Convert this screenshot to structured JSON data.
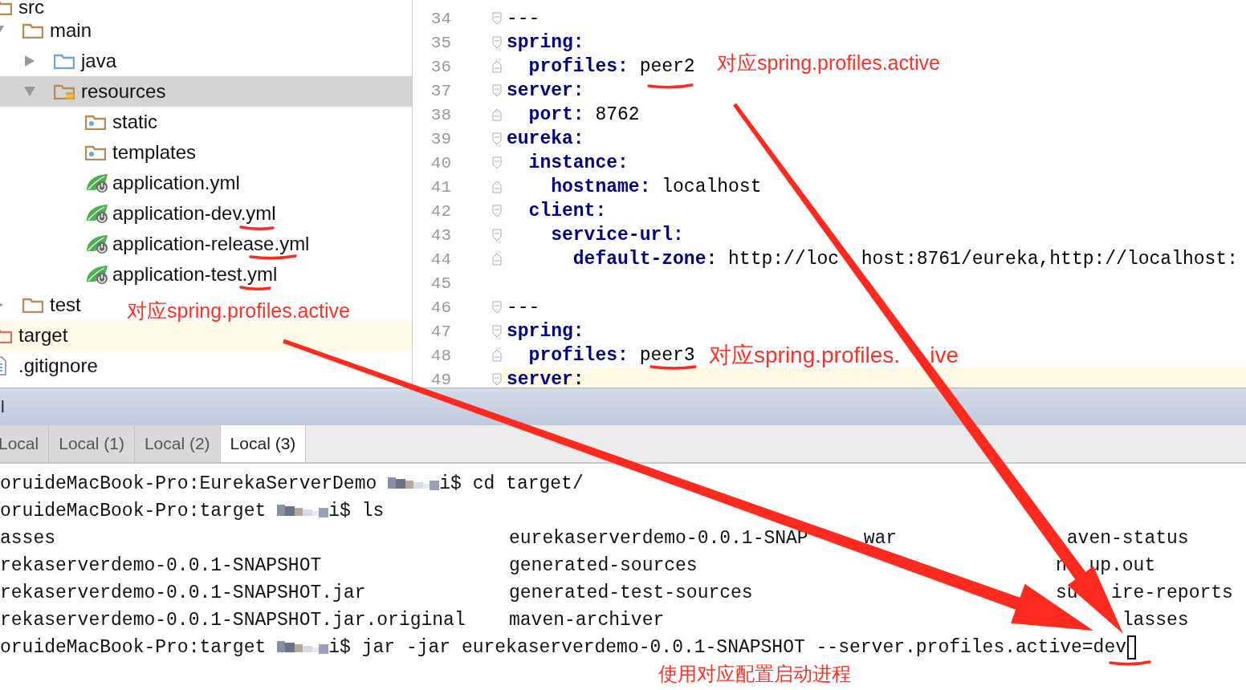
{
  "project_tree": {
    "items": [
      {
        "label": "src",
        "kind": "folder",
        "selected": false,
        "highlighted": false,
        "children": [
          {
            "label": "main",
            "kind": "folder",
            "expanded": true,
            "selected": false,
            "highlighted": false,
            "children": [
              {
                "label": "java",
                "kind": "source-folder",
                "expanded": false,
                "selected": false,
                "highlighted": false
              },
              {
                "label": "resources",
                "kind": "resources-folder",
                "expanded": true,
                "selected": true,
                "highlighted": false,
                "children": [
                  {
                    "label": "static",
                    "kind": "web-folder",
                    "selected": false,
                    "highlighted": false
                  },
                  {
                    "label": "templates",
                    "kind": "web-folder",
                    "selected": false,
                    "highlighted": false
                  },
                  {
                    "label": "application.yml",
                    "kind": "spring-config",
                    "selected": false,
                    "highlighted": false
                  },
                  {
                    "label": "application-dev.yml",
                    "kind": "spring-config",
                    "selected": false,
                    "highlighted": false
                  },
                  {
                    "label": "application-release.yml",
                    "kind": "spring-config",
                    "selected": false,
                    "highlighted": false
                  },
                  {
                    "label": "application-test.yml",
                    "kind": "spring-config",
                    "selected": false,
                    "highlighted": false
                  }
                ]
              }
            ]
          },
          {
            "label": "test",
            "kind": "folder",
            "expanded": false,
            "selected": false,
            "highlighted": false
          }
        ]
      },
      {
        "label": "target",
        "kind": "excluded-folder",
        "selected": false,
        "highlighted": true
      },
      {
        "label": ".gitignore",
        "kind": "text-file",
        "selected": false,
        "highlighted": false
      }
    ]
  },
  "editor": {
    "lines": [
      {
        "number": "34",
        "fold_start": true,
        "current": false,
        "segments": [
          {
            "kind": "plain",
            "text": "---"
          }
        ]
      },
      {
        "number": "35",
        "fold_start": true,
        "current": false,
        "segments": [
          {
            "kind": "key",
            "text": "spring:"
          }
        ]
      },
      {
        "number": "36",
        "fold_start": false,
        "current": false,
        "segments": [
          {
            "kind": "key",
            "text": "  profiles:"
          },
          {
            "kind": "plain",
            "text": " peer2"
          }
        ]
      },
      {
        "number": "37",
        "fold_start": true,
        "current": false,
        "segments": [
          {
            "kind": "key",
            "text": "server:"
          }
        ]
      },
      {
        "number": "38",
        "fold_start": false,
        "current": false,
        "segments": [
          {
            "kind": "key",
            "text": "  port:"
          },
          {
            "kind": "plain",
            "text": " 8762"
          }
        ]
      },
      {
        "number": "39",
        "fold_start": true,
        "current": false,
        "segments": [
          {
            "kind": "key",
            "text": "eureka:"
          }
        ]
      },
      {
        "number": "40",
        "fold_start": true,
        "current": false,
        "segments": [
          {
            "kind": "key",
            "text": "  instance:"
          }
        ]
      },
      {
        "number": "41",
        "fold_start": false,
        "current": false,
        "segments": [
          {
            "kind": "key",
            "text": "    hostname:"
          },
          {
            "kind": "plain",
            "text": " localhost"
          }
        ]
      },
      {
        "number": "42",
        "fold_start": true,
        "current": false,
        "segments": [
          {
            "kind": "key",
            "text": "  client:"
          }
        ]
      },
      {
        "number": "43",
        "fold_start": true,
        "current": false,
        "segments": [
          {
            "kind": "key",
            "text": "    service-url:"
          }
        ]
      },
      {
        "number": "44",
        "fold_start": false,
        "current": false,
        "segments": [
          {
            "kind": "key",
            "text": "      default-zone:"
          },
          {
            "kind": "plain",
            "parts": [
              " http://loc",
              "host:8761/eureka,http://localhost:"
            ]
          }
        ]
      },
      {
        "number": "45",
        "current": false
      },
      {
        "number": "46",
        "fold_start": true,
        "current": false,
        "segments": [
          {
            "kind": "plain",
            "text": "---"
          }
        ]
      },
      {
        "number": "47",
        "fold_start": true,
        "current": false,
        "segments": [
          {
            "kind": "key",
            "text": "spring:"
          }
        ]
      },
      {
        "number": "48",
        "fold_start": false,
        "current": false,
        "segments": [
          {
            "kind": "key",
            "text": "  profiles:"
          },
          {
            "kind": "plain",
            "text": " peer3"
          }
        ]
      },
      {
        "number": "49",
        "fold_start": true,
        "current": true,
        "segments": [
          {
            "kind": "key",
            "text": "server:"
          }
        ]
      }
    ]
  },
  "tool_window": {
    "title": "l",
    "tabs": [
      {
        "label": "Local",
        "selected": false
      },
      {
        "label": "Local (1)",
        "selected": false
      },
      {
        "label": "Local (2)",
        "selected": false
      },
      {
        "label": "Local (3)",
        "selected": true
      }
    ],
    "terminal_lines": [
      {
        "kind": "prompt",
        "host": "oruideMacBook-Pro:EurekaServerDemo",
        "suffix": "i$",
        "command": "cd target/",
        "cursor": false
      },
      {
        "kind": "prompt",
        "host": "oruideMacBook-Pro:target",
        "suffix": "i$",
        "command": "ls",
        "cursor": false
      },
      {
        "kind": "listing",
        "columns": [
          {
            "parts": [
              "asses"
            ]
          },
          {
            "parts": [
              "eurekaserverdemo-0.0.1-SNAP",
              "war"
            ]
          },
          {
            "parts": [
              "aven-status"
            ]
          }
        ]
      },
      {
        "kind": "listing",
        "columns": [
          {
            "parts": [
              "rekaserverdemo-0.0.1-SNAPSHOT"
            ]
          },
          {
            "parts": [
              "generated-sources"
            ]
          },
          {
            "parts": [
              "n",
              "up.out"
            ]
          }
        ]
      },
      {
        "kind": "listing",
        "columns": [
          {
            "parts": [
              "rekaserverdemo-0.0.1-SNAPSHOT.jar"
            ]
          },
          {
            "parts": [
              "generated-test-sources"
            ]
          },
          {
            "parts": [
              "su",
              "ire-reports"
            ]
          }
        ]
      },
      {
        "kind": "listing",
        "columns": [
          {
            "parts": [
              "rekaserverdemo-0.0.1-SNAPSHOT.jar.original"
            ]
          },
          {
            "parts": [
              "maven-archiver"
            ]
          },
          {
            "parts": [
              "lasses"
            ]
          }
        ]
      },
      {
        "kind": "prompt",
        "host": "oruideMacBook-Pro:target",
        "suffix": "i$",
        "command": "jar -jar eurekaserverdemo-0.0.1-SNAPSHOT --server.profiles.active=dev",
        "cursor": true
      }
    ]
  },
  "annotations": {
    "notes": [
      {
        "parts": [
          "对应spring.profiles.active"
        ]
      },
      {
        "parts": [
          "对应spring.profiles.active"
        ]
      },
      {
        "parts": [
          "对应spring.profiles.",
          "ive"
        ]
      },
      {
        "parts": [
          "使用对应配置启动进程"
        ]
      }
    ]
  }
}
